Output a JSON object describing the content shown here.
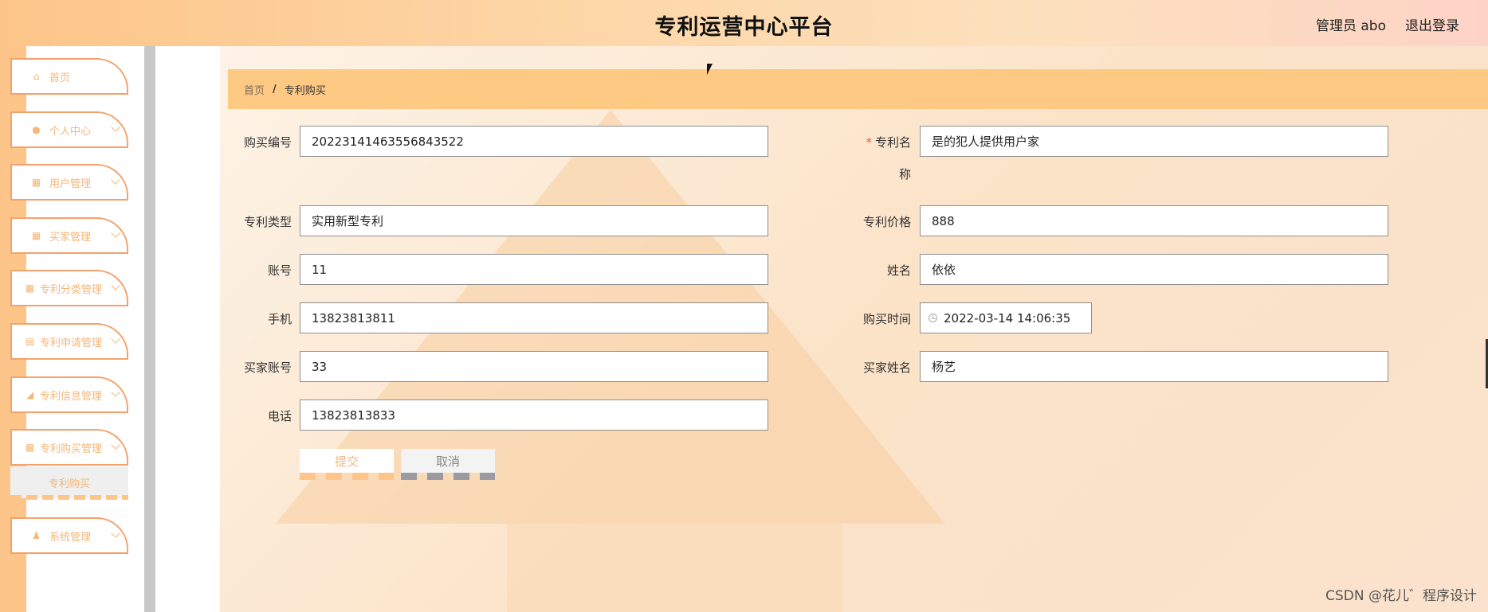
{
  "header": {
    "title": "专利运营中心平台",
    "user_label": "管理员 abo",
    "logout_label": "退出登录"
  },
  "sidebar": {
    "items": [
      {
        "label": "首页",
        "icon": "home-icon"
      },
      {
        "label": "个人中心",
        "icon": "user-icon"
      },
      {
        "label": "用户管理",
        "icon": "grid-icon"
      },
      {
        "label": "买家管理",
        "icon": "grid-icon"
      },
      {
        "label": "专利分类管理",
        "icon": "grid-icon"
      },
      {
        "label": "专利申请管理",
        "icon": "doc-icon"
      },
      {
        "label": "专利信息管理",
        "icon": "thumb-icon"
      },
      {
        "label": "专利购买管理",
        "icon": "grid-icon"
      },
      {
        "label": "系统管理",
        "icon": "person-icon"
      }
    ],
    "submenu": {
      "label": "专利购买"
    }
  },
  "breadcrumb": {
    "home": "首页",
    "separator": "/",
    "current": "专利购买"
  },
  "form": {
    "purchase_no": {
      "label": "购买编号",
      "value": "20223141463556843522"
    },
    "patent_name": {
      "label_line1": "专利名",
      "label_line2": "称",
      "required_mark": "*",
      "value": "是的犯人提供用户家"
    },
    "patent_type": {
      "label": "专利类型",
      "value": "实用新型专利"
    },
    "patent_price": {
      "label": "专利价格",
      "value": "888"
    },
    "account": {
      "label": "账号",
      "value": "11"
    },
    "name": {
      "label": "姓名",
      "value": "依依"
    },
    "phone": {
      "label": "手机",
      "value": "13823813811"
    },
    "purchase_time": {
      "label": "购买时间",
      "value": "2022-03-14 14:06:35"
    },
    "buyer_account": {
      "label": "买家账号",
      "value": "33"
    },
    "buyer_name": {
      "label": "买家姓名",
      "value": "杨艺"
    },
    "telephone": {
      "label": "电话",
      "value": "13823813833"
    },
    "submit_label": "提交",
    "cancel_label": "取消"
  },
  "watermark": "CSDN @花儿゛程序设计",
  "colors": {
    "accent": "#fdc58a",
    "menu_border": "#f4a26c",
    "menu_text": "#f4b67a",
    "breadcrumb_bg": "#fdc983"
  }
}
